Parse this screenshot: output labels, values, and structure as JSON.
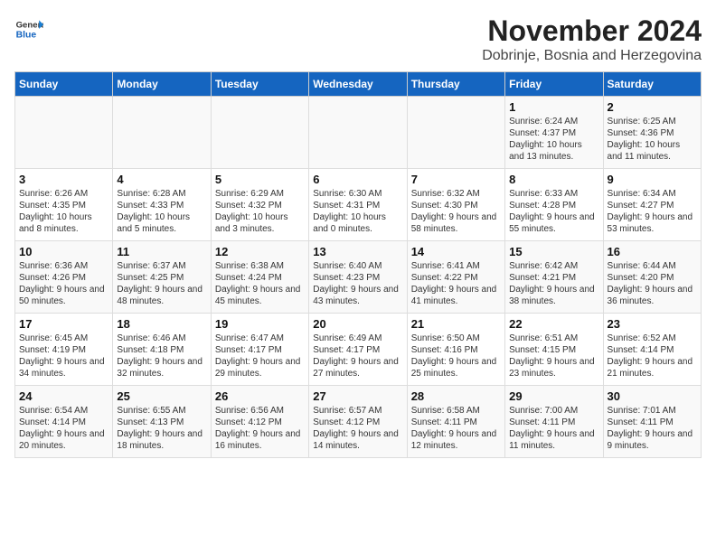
{
  "header": {
    "logo_line1": "General",
    "logo_line2": "Blue",
    "title": "November 2024",
    "subtitle": "Dobrinje, Bosnia and Herzegovina"
  },
  "calendar": {
    "days_of_week": [
      "Sunday",
      "Monday",
      "Tuesday",
      "Wednesday",
      "Thursday",
      "Friday",
      "Saturday"
    ],
    "weeks": [
      [
        {
          "day": "",
          "info": ""
        },
        {
          "day": "",
          "info": ""
        },
        {
          "day": "",
          "info": ""
        },
        {
          "day": "",
          "info": ""
        },
        {
          "day": "",
          "info": ""
        },
        {
          "day": "1",
          "info": "Sunrise: 6:24 AM\nSunset: 4:37 PM\nDaylight: 10 hours and 13 minutes."
        },
        {
          "day": "2",
          "info": "Sunrise: 6:25 AM\nSunset: 4:36 PM\nDaylight: 10 hours and 11 minutes."
        }
      ],
      [
        {
          "day": "3",
          "info": "Sunrise: 6:26 AM\nSunset: 4:35 PM\nDaylight: 10 hours and 8 minutes."
        },
        {
          "day": "4",
          "info": "Sunrise: 6:28 AM\nSunset: 4:33 PM\nDaylight: 10 hours and 5 minutes."
        },
        {
          "day": "5",
          "info": "Sunrise: 6:29 AM\nSunset: 4:32 PM\nDaylight: 10 hours and 3 minutes."
        },
        {
          "day": "6",
          "info": "Sunrise: 6:30 AM\nSunset: 4:31 PM\nDaylight: 10 hours and 0 minutes."
        },
        {
          "day": "7",
          "info": "Sunrise: 6:32 AM\nSunset: 4:30 PM\nDaylight: 9 hours and 58 minutes."
        },
        {
          "day": "8",
          "info": "Sunrise: 6:33 AM\nSunset: 4:28 PM\nDaylight: 9 hours and 55 minutes."
        },
        {
          "day": "9",
          "info": "Sunrise: 6:34 AM\nSunset: 4:27 PM\nDaylight: 9 hours and 53 minutes."
        }
      ],
      [
        {
          "day": "10",
          "info": "Sunrise: 6:36 AM\nSunset: 4:26 PM\nDaylight: 9 hours and 50 minutes."
        },
        {
          "day": "11",
          "info": "Sunrise: 6:37 AM\nSunset: 4:25 PM\nDaylight: 9 hours and 48 minutes."
        },
        {
          "day": "12",
          "info": "Sunrise: 6:38 AM\nSunset: 4:24 PM\nDaylight: 9 hours and 45 minutes."
        },
        {
          "day": "13",
          "info": "Sunrise: 6:40 AM\nSunset: 4:23 PM\nDaylight: 9 hours and 43 minutes."
        },
        {
          "day": "14",
          "info": "Sunrise: 6:41 AM\nSunset: 4:22 PM\nDaylight: 9 hours and 41 minutes."
        },
        {
          "day": "15",
          "info": "Sunrise: 6:42 AM\nSunset: 4:21 PM\nDaylight: 9 hours and 38 minutes."
        },
        {
          "day": "16",
          "info": "Sunrise: 6:44 AM\nSunset: 4:20 PM\nDaylight: 9 hours and 36 minutes."
        }
      ],
      [
        {
          "day": "17",
          "info": "Sunrise: 6:45 AM\nSunset: 4:19 PM\nDaylight: 9 hours and 34 minutes."
        },
        {
          "day": "18",
          "info": "Sunrise: 6:46 AM\nSunset: 4:18 PM\nDaylight: 9 hours and 32 minutes."
        },
        {
          "day": "19",
          "info": "Sunrise: 6:47 AM\nSunset: 4:17 PM\nDaylight: 9 hours and 29 minutes."
        },
        {
          "day": "20",
          "info": "Sunrise: 6:49 AM\nSunset: 4:17 PM\nDaylight: 9 hours and 27 minutes."
        },
        {
          "day": "21",
          "info": "Sunrise: 6:50 AM\nSunset: 4:16 PM\nDaylight: 9 hours and 25 minutes."
        },
        {
          "day": "22",
          "info": "Sunrise: 6:51 AM\nSunset: 4:15 PM\nDaylight: 9 hours and 23 minutes."
        },
        {
          "day": "23",
          "info": "Sunrise: 6:52 AM\nSunset: 4:14 PM\nDaylight: 9 hours and 21 minutes."
        }
      ],
      [
        {
          "day": "24",
          "info": "Sunrise: 6:54 AM\nSunset: 4:14 PM\nDaylight: 9 hours and 20 minutes."
        },
        {
          "day": "25",
          "info": "Sunrise: 6:55 AM\nSunset: 4:13 PM\nDaylight: 9 hours and 18 minutes."
        },
        {
          "day": "26",
          "info": "Sunrise: 6:56 AM\nSunset: 4:12 PM\nDaylight: 9 hours and 16 minutes."
        },
        {
          "day": "27",
          "info": "Sunrise: 6:57 AM\nSunset: 4:12 PM\nDaylight: 9 hours and 14 minutes."
        },
        {
          "day": "28",
          "info": "Sunrise: 6:58 AM\nSunset: 4:11 PM\nDaylight: 9 hours and 12 minutes."
        },
        {
          "day": "29",
          "info": "Sunrise: 7:00 AM\nSunset: 4:11 PM\nDaylight: 9 hours and 11 minutes."
        },
        {
          "day": "30",
          "info": "Sunrise: 7:01 AM\nSunset: 4:11 PM\nDaylight: 9 hours and 9 minutes."
        }
      ]
    ]
  }
}
